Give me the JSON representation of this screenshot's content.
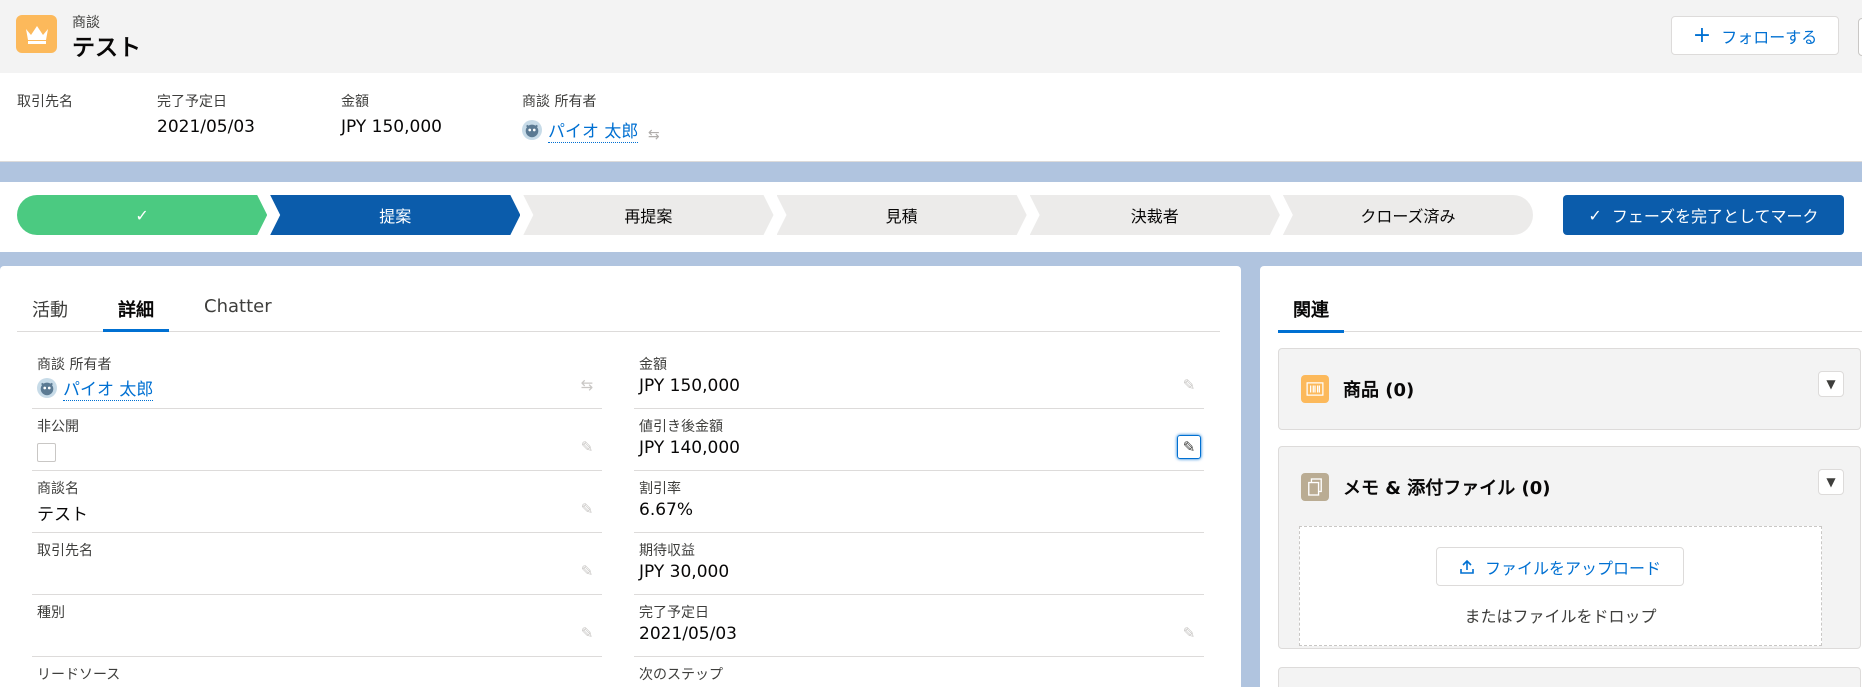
{
  "header": {
    "object_type": "商談",
    "title": "テスト",
    "follow_label": "フォローする",
    "fields": [
      {
        "label": "取引先名",
        "value": ""
      },
      {
        "label": "完了予定日",
        "value": "2021/05/03"
      },
      {
        "label": "金額",
        "value": "JPY 150,000"
      },
      {
        "label": "商談 所有者",
        "value": "パイオ 太郎"
      }
    ]
  },
  "path": {
    "stages": [
      {
        "label": "✓",
        "status": "complete"
      },
      {
        "label": "提案",
        "status": "current"
      },
      {
        "label": "再提案",
        "status": "incomplete"
      },
      {
        "label": "見積",
        "status": "incomplete"
      },
      {
        "label": "決裁者",
        "status": "incomplete"
      },
      {
        "label": "クローズ済み",
        "status": "incomplete"
      }
    ],
    "mark_button_label": "フェーズを完了としてマーク"
  },
  "tabs": [
    {
      "label": "活動",
      "active": false
    },
    {
      "label": "詳細",
      "active": true
    },
    {
      "label": "Chatter",
      "active": false
    }
  ],
  "details": {
    "left": [
      {
        "label": "商談 所有者",
        "value": "パイオ 太郎"
      },
      {
        "label": "非公開",
        "value": ""
      },
      {
        "label": "商談名",
        "value": "テスト"
      },
      {
        "label": "取引先名",
        "value": ""
      },
      {
        "label": "種別",
        "value": ""
      },
      {
        "label": "リードソース",
        "value": ""
      }
    ],
    "right": [
      {
        "label": "金額",
        "value": "JPY 150,000"
      },
      {
        "label": "値引き後金額",
        "value": "JPY 140,000"
      },
      {
        "label": "割引率",
        "value": "6.67%"
      },
      {
        "label": "期待収益",
        "value": "JPY 30,000"
      },
      {
        "label": "完了予定日",
        "value": "2021/05/03"
      },
      {
        "label": "次のステップ",
        "value": ""
      }
    ]
  },
  "related": {
    "tab_label": "関連",
    "products_title": "商品 (0)",
    "notes_title": "メモ & 添付ファイル (0)",
    "upload_label": "ファイルをアップロード",
    "drop_text": "またはファイルをドロップ"
  },
  "colors": {
    "brand": "#0b5cab",
    "complete": "#4bca81",
    "link": "#0070d2",
    "product_icon": "#fcb95b",
    "notes_icon": "#baac93"
  }
}
